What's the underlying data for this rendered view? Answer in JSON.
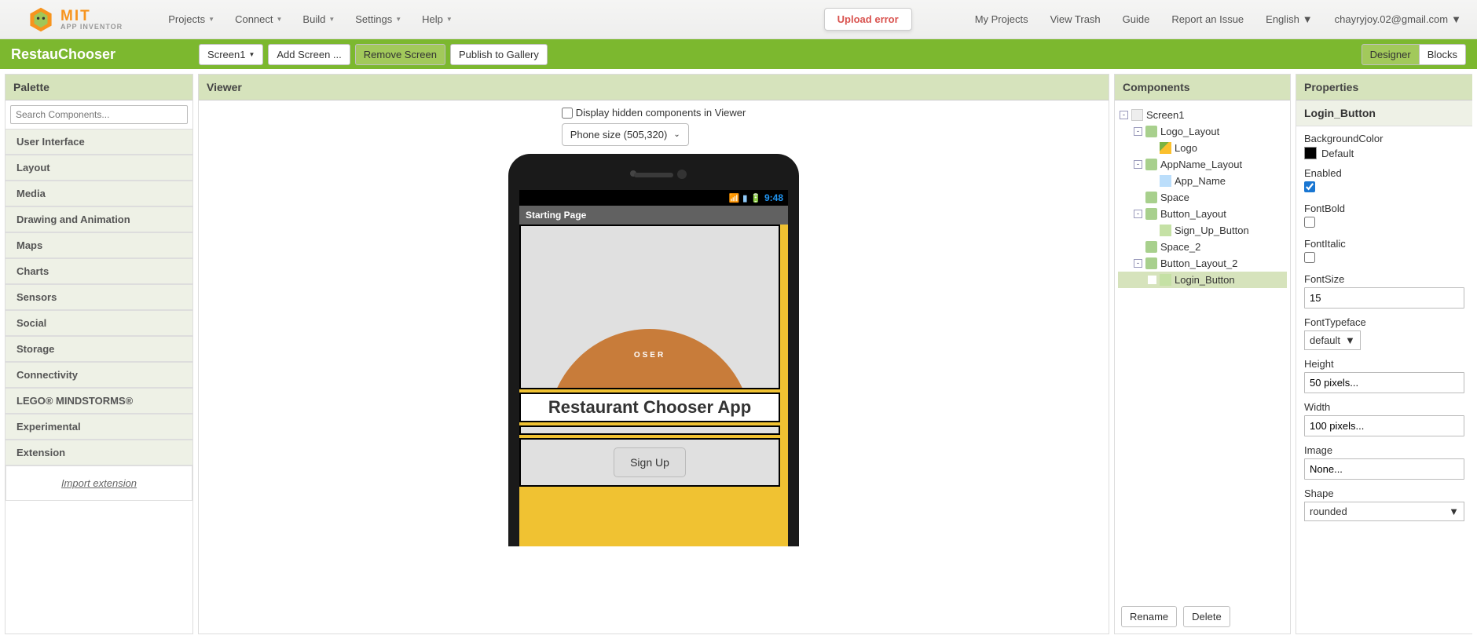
{
  "topnav": {
    "logo_top": "MIT",
    "logo_bottom": "APP INVENTOR",
    "menus": [
      "Projects",
      "Connect",
      "Build",
      "Settings",
      "Help"
    ],
    "upload_error": "Upload error",
    "right_items": [
      "My Projects",
      "View Trash",
      "Guide",
      "Report an Issue"
    ],
    "language": "English",
    "account": "chayryjoy.02@gmail.com"
  },
  "projectbar": {
    "title": "RestauChooser",
    "screen_dropdown": "Screen1",
    "add_screen": "Add Screen ...",
    "remove_screen": "Remove Screen",
    "publish": "Publish to Gallery",
    "designer": "Designer",
    "blocks": "Blocks"
  },
  "palette": {
    "header": "Palette",
    "search_placeholder": "Search Components...",
    "categories": [
      "User Interface",
      "Layout",
      "Media",
      "Drawing and Animation",
      "Maps",
      "Charts",
      "Sensors",
      "Social",
      "Storage",
      "Connectivity",
      "LEGO® MINDSTORMS®",
      "Experimental",
      "Extension"
    ],
    "import": "Import extension"
  },
  "viewer": {
    "header": "Viewer",
    "hidden_label": "Display hidden components in Viewer",
    "size_dropdown": "Phone size (505,320)",
    "status_time": "9:48",
    "screen_title": "Starting Page",
    "logo_arc_text": "OSER",
    "app_name": "Restaurant Chooser App",
    "signup": "Sign Up"
  },
  "components": {
    "header": "Components",
    "tree": [
      {
        "name": "Screen1",
        "icon": "form",
        "level": 1,
        "expand": "-"
      },
      {
        "name": "Logo_Layout",
        "icon": "layout",
        "level": 2,
        "expand": "-"
      },
      {
        "name": "Logo",
        "icon": "image",
        "level": 3,
        "expand": ""
      },
      {
        "name": "AppName_Layout",
        "icon": "layout",
        "level": 2,
        "expand": "-"
      },
      {
        "name": "App_Name",
        "icon": "label",
        "level": 3,
        "expand": ""
      },
      {
        "name": "Space",
        "icon": "layout",
        "level": 2,
        "expand": ""
      },
      {
        "name": "Button_Layout",
        "icon": "layout",
        "level": 2,
        "expand": "-"
      },
      {
        "name": "Sign_Up_Button",
        "icon": "button",
        "level": 3,
        "expand": ""
      },
      {
        "name": "Space_2",
        "icon": "layout",
        "level": 2,
        "expand": ""
      },
      {
        "name": "Button_Layout_2",
        "icon": "layout",
        "level": 2,
        "expand": "-"
      },
      {
        "name": "Login_Button",
        "icon": "button",
        "level": 3,
        "expand": "",
        "selected": true
      }
    ],
    "rename": "Rename",
    "delete": "Delete"
  },
  "properties": {
    "header": "Properties",
    "selected": "Login_Button",
    "BackgroundColor_label": "BackgroundColor",
    "BackgroundColor_value": "Default",
    "Enabled_label": "Enabled",
    "Enabled_checked": true,
    "FontBold_label": "FontBold",
    "FontBold_checked": false,
    "FontItalic_label": "FontItalic",
    "FontItalic_checked": false,
    "FontSize_label": "FontSize",
    "FontSize_value": "15",
    "FontTypeface_label": "FontTypeface",
    "FontTypeface_value": "default",
    "Height_label": "Height",
    "Height_value": "50 pixels...",
    "Width_label": "Width",
    "Width_value": "100 pixels...",
    "Image_label": "Image",
    "Image_value": "None...",
    "Shape_label": "Shape",
    "Shape_value": "rounded"
  }
}
